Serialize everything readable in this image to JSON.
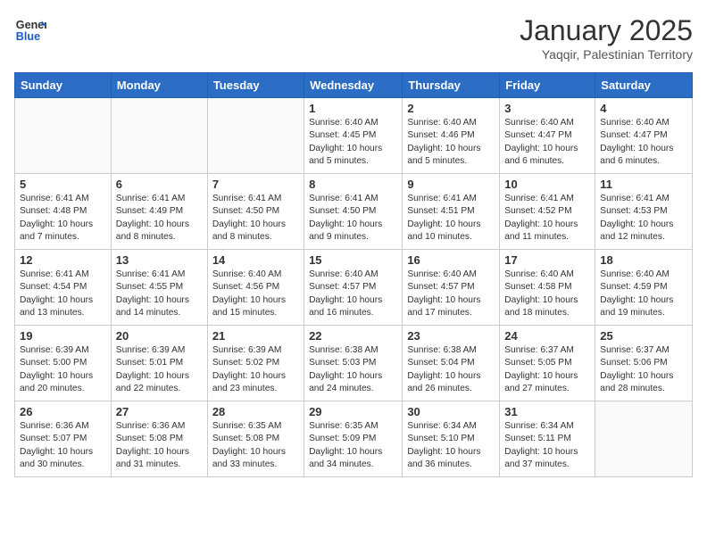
{
  "header": {
    "logo_line1": "General",
    "logo_line2": "Blue",
    "month_title": "January 2025",
    "subtitle": "Yaqqir, Palestinian Territory"
  },
  "days_of_week": [
    "Sunday",
    "Monday",
    "Tuesday",
    "Wednesday",
    "Thursday",
    "Friday",
    "Saturday"
  ],
  "weeks": [
    [
      {
        "day": "",
        "info": ""
      },
      {
        "day": "",
        "info": ""
      },
      {
        "day": "",
        "info": ""
      },
      {
        "day": "1",
        "info": "Sunrise: 6:40 AM\nSunset: 4:45 PM\nDaylight: 10 hours\nand 5 minutes."
      },
      {
        "day": "2",
        "info": "Sunrise: 6:40 AM\nSunset: 4:46 PM\nDaylight: 10 hours\nand 5 minutes."
      },
      {
        "day": "3",
        "info": "Sunrise: 6:40 AM\nSunset: 4:47 PM\nDaylight: 10 hours\nand 6 minutes."
      },
      {
        "day": "4",
        "info": "Sunrise: 6:40 AM\nSunset: 4:47 PM\nDaylight: 10 hours\nand 6 minutes."
      }
    ],
    [
      {
        "day": "5",
        "info": "Sunrise: 6:41 AM\nSunset: 4:48 PM\nDaylight: 10 hours\nand 7 minutes."
      },
      {
        "day": "6",
        "info": "Sunrise: 6:41 AM\nSunset: 4:49 PM\nDaylight: 10 hours\nand 8 minutes."
      },
      {
        "day": "7",
        "info": "Sunrise: 6:41 AM\nSunset: 4:50 PM\nDaylight: 10 hours\nand 8 minutes."
      },
      {
        "day": "8",
        "info": "Sunrise: 6:41 AM\nSunset: 4:50 PM\nDaylight: 10 hours\nand 9 minutes."
      },
      {
        "day": "9",
        "info": "Sunrise: 6:41 AM\nSunset: 4:51 PM\nDaylight: 10 hours\nand 10 minutes."
      },
      {
        "day": "10",
        "info": "Sunrise: 6:41 AM\nSunset: 4:52 PM\nDaylight: 10 hours\nand 11 minutes."
      },
      {
        "day": "11",
        "info": "Sunrise: 6:41 AM\nSunset: 4:53 PM\nDaylight: 10 hours\nand 12 minutes."
      }
    ],
    [
      {
        "day": "12",
        "info": "Sunrise: 6:41 AM\nSunset: 4:54 PM\nDaylight: 10 hours\nand 13 minutes."
      },
      {
        "day": "13",
        "info": "Sunrise: 6:41 AM\nSunset: 4:55 PM\nDaylight: 10 hours\nand 14 minutes."
      },
      {
        "day": "14",
        "info": "Sunrise: 6:40 AM\nSunset: 4:56 PM\nDaylight: 10 hours\nand 15 minutes."
      },
      {
        "day": "15",
        "info": "Sunrise: 6:40 AM\nSunset: 4:57 PM\nDaylight: 10 hours\nand 16 minutes."
      },
      {
        "day": "16",
        "info": "Sunrise: 6:40 AM\nSunset: 4:57 PM\nDaylight: 10 hours\nand 17 minutes."
      },
      {
        "day": "17",
        "info": "Sunrise: 6:40 AM\nSunset: 4:58 PM\nDaylight: 10 hours\nand 18 minutes."
      },
      {
        "day": "18",
        "info": "Sunrise: 6:40 AM\nSunset: 4:59 PM\nDaylight: 10 hours\nand 19 minutes."
      }
    ],
    [
      {
        "day": "19",
        "info": "Sunrise: 6:39 AM\nSunset: 5:00 PM\nDaylight: 10 hours\nand 20 minutes."
      },
      {
        "day": "20",
        "info": "Sunrise: 6:39 AM\nSunset: 5:01 PM\nDaylight: 10 hours\nand 22 minutes."
      },
      {
        "day": "21",
        "info": "Sunrise: 6:39 AM\nSunset: 5:02 PM\nDaylight: 10 hours\nand 23 minutes."
      },
      {
        "day": "22",
        "info": "Sunrise: 6:38 AM\nSunset: 5:03 PM\nDaylight: 10 hours\nand 24 minutes."
      },
      {
        "day": "23",
        "info": "Sunrise: 6:38 AM\nSunset: 5:04 PM\nDaylight: 10 hours\nand 26 minutes."
      },
      {
        "day": "24",
        "info": "Sunrise: 6:37 AM\nSunset: 5:05 PM\nDaylight: 10 hours\nand 27 minutes."
      },
      {
        "day": "25",
        "info": "Sunrise: 6:37 AM\nSunset: 5:06 PM\nDaylight: 10 hours\nand 28 minutes."
      }
    ],
    [
      {
        "day": "26",
        "info": "Sunrise: 6:36 AM\nSunset: 5:07 PM\nDaylight: 10 hours\nand 30 minutes."
      },
      {
        "day": "27",
        "info": "Sunrise: 6:36 AM\nSunset: 5:08 PM\nDaylight: 10 hours\nand 31 minutes."
      },
      {
        "day": "28",
        "info": "Sunrise: 6:35 AM\nSunset: 5:08 PM\nDaylight: 10 hours\nand 33 minutes."
      },
      {
        "day": "29",
        "info": "Sunrise: 6:35 AM\nSunset: 5:09 PM\nDaylight: 10 hours\nand 34 minutes."
      },
      {
        "day": "30",
        "info": "Sunrise: 6:34 AM\nSunset: 5:10 PM\nDaylight: 10 hours\nand 36 minutes."
      },
      {
        "day": "31",
        "info": "Sunrise: 6:34 AM\nSunset: 5:11 PM\nDaylight: 10 hours\nand 37 minutes."
      },
      {
        "day": "",
        "info": ""
      }
    ]
  ]
}
